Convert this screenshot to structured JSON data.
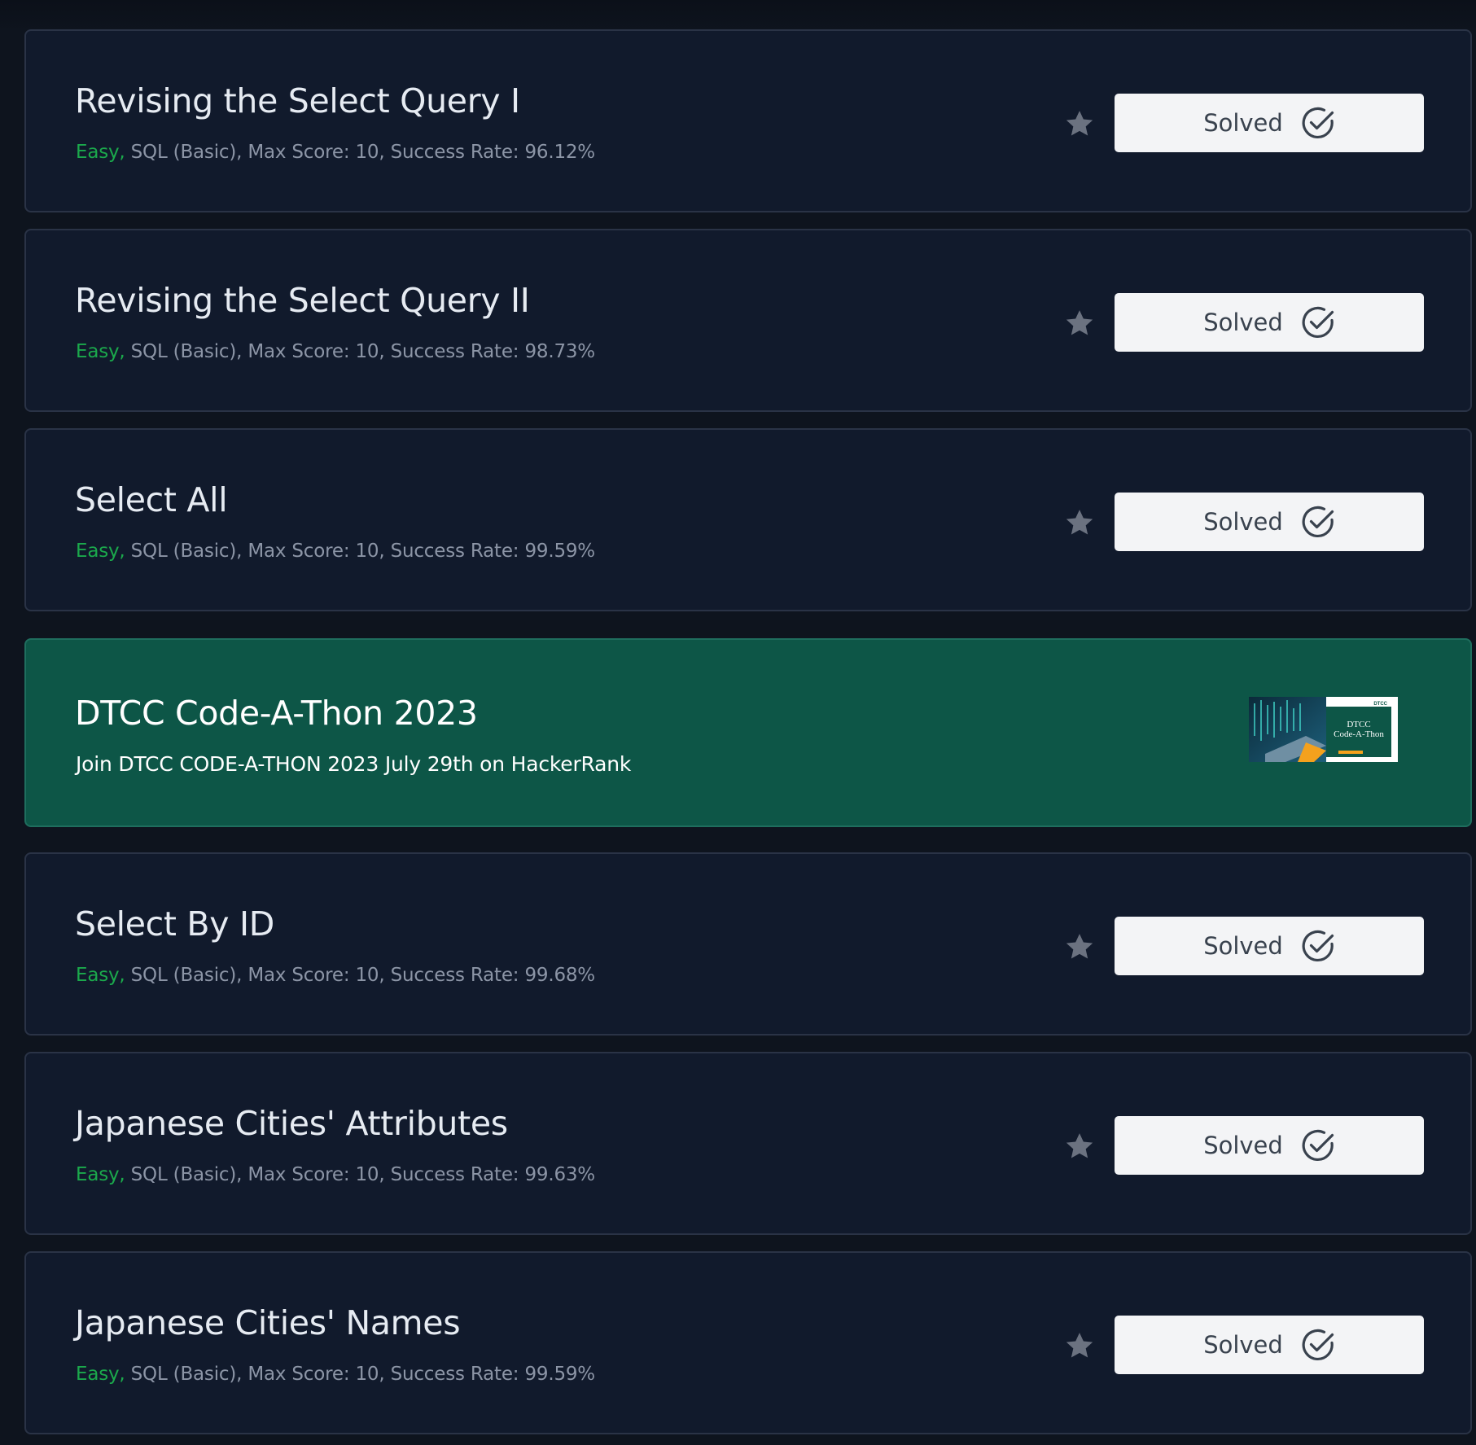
{
  "challenges": [
    {
      "title": "Revising the Select Query I",
      "difficulty": "Easy,",
      "details": " SQL (Basic), Max Score: 10, Success Rate: 96.12%",
      "status": "Solved"
    },
    {
      "title": "Revising the Select Query II",
      "difficulty": "Easy,",
      "details": " SQL (Basic), Max Score: 10, Success Rate: 98.73%",
      "status": "Solved"
    },
    {
      "title": "Select All",
      "difficulty": "Easy,",
      "details": " SQL (Basic), Max Score: 10, Success Rate: 99.59%",
      "status": "Solved"
    },
    {
      "title": "Select By ID",
      "difficulty": "Easy,",
      "details": " SQL (Basic), Max Score: 10, Success Rate: 99.68%",
      "status": "Solved"
    },
    {
      "title": "Japanese Cities' Attributes",
      "difficulty": "Easy,",
      "details": " SQL (Basic), Max Score: 10, Success Rate: 99.63%",
      "status": "Solved"
    },
    {
      "title": "Japanese Cities' Names",
      "difficulty": "Easy,",
      "details": " SQL (Basic), Max Score: 10, Success Rate: 99.59%",
      "status": "Solved"
    }
  ],
  "promo": {
    "title": "DTCC Code-A-Thon 2023",
    "subtitle": "Join DTCC CODE-A-THON 2023 July 29th on HackerRank",
    "banner_logo": "DTCC",
    "banner_title": "DTCC",
    "banner_title_2": "Code-A-Thon"
  },
  "icons": {
    "star": "star-icon",
    "check": "check-circle-icon"
  },
  "colors": {
    "background": "#0e141e",
    "card": "#111a2c",
    "easy": "#1ba94c",
    "promo": "#0d5647",
    "solved_button": "#f3f4f6"
  }
}
